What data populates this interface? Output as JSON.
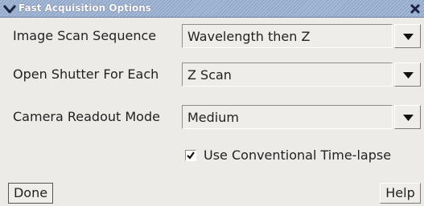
{
  "window": {
    "title": "Fast Acquisition Options"
  },
  "rows": [
    {
      "label": "Image Scan Sequence",
      "value": "Wavelength then Z"
    },
    {
      "label": "Open Shutter For Each",
      "value": "Z Scan"
    },
    {
      "label": "Camera Readout Mode",
      "value": "Medium"
    }
  ],
  "checkbox": {
    "label": "Use Conventional Time-lapse",
    "checked": true
  },
  "buttons": {
    "done": "Done",
    "help": "Help"
  },
  "icons": {
    "title_menu": "chevron-down-icon",
    "title_close": "close-icon",
    "dropdown": "triangle-down-icon",
    "check": "check-icon"
  }
}
